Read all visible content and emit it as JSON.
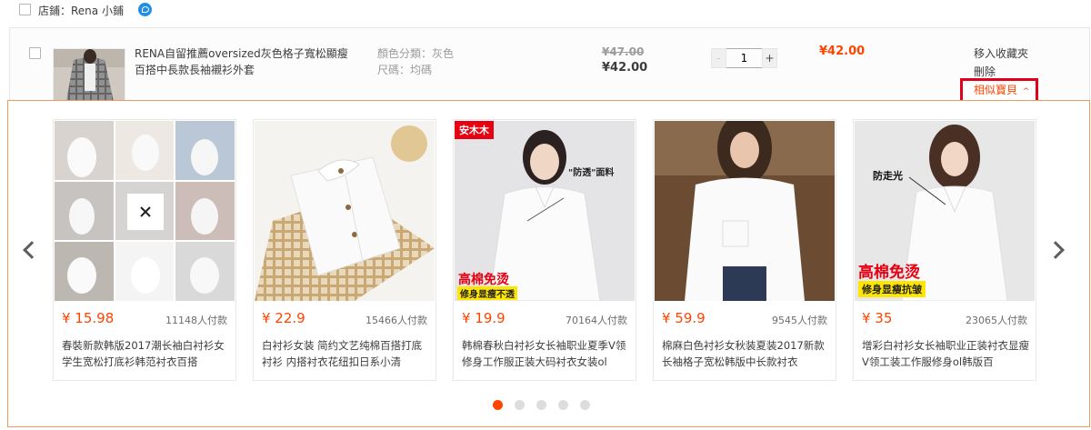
{
  "shop": {
    "label": "店鋪：Rena 小鋪"
  },
  "item": {
    "title": "RENA自留推薦oversized灰色格子寬松顯瘦百搭中長款長袖襯衫外套",
    "sku_color": "顏色分類：灰色",
    "sku_size": "尺碼：均碼",
    "original_price": "¥47.00",
    "price": "¥42.00",
    "quantity": "1",
    "qty_minus": "-",
    "qty_plus": "+",
    "subtotal": "¥42.00",
    "move_to_favorites": "移入收藏夾",
    "delete": "刪除",
    "similar": "相似寶貝",
    "similar_caret": "^"
  },
  "similar_items": [
    {
      "price": "¥ 15.98",
      "sold": "11148人付款",
      "title": "春裝新款韩版2017潮长袖白衬衫女学生宽松打底衫韩范衬衣百搭"
    },
    {
      "price": "¥ 22.9",
      "sold": "15466人付款",
      "title": "白衬衫女装 简约文艺纯棉百搭打底衬衫 内搭衬衣花纽扣日系小清"
    },
    {
      "price": "¥ 19.9",
      "sold": "70164人付款",
      "title": "韩棉春秋白衬衫女长袖职业夏季V领修身工作服正装大码衬衣女装ol",
      "badge": "安木木",
      "tag1": "\"防透\"面料",
      "tag2": "高棉免烫",
      "tag3": "修身显瘦不透"
    },
    {
      "price": "¥ 59.9",
      "sold": "9545人付款",
      "title": "棉麻白色衬衫女秋装夏装2017新款长袖格子宽松韩版中长款衬衣"
    },
    {
      "price": "¥ 35",
      "sold": "23065人付款",
      "title": "增彩白衬衫女长袖职业正装衬衣显瘦V领工装工作服修身ol韩版百",
      "tag1": "防走光",
      "tag2": "高棉免烫",
      "tag3": "修身显瘦抗皱"
    }
  ],
  "colors": {
    "accent": "#ff4400",
    "highlight_border": "#e0001b",
    "panel_border": "#ec9a60"
  }
}
